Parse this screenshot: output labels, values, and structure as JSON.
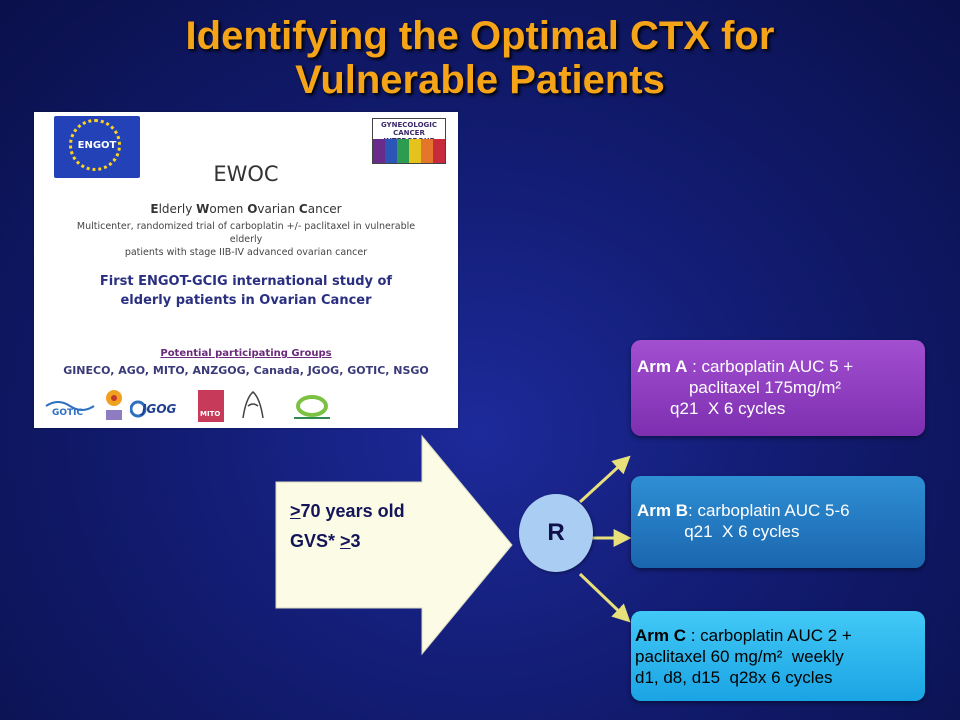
{
  "title": {
    "line1": "Identifying the Optimal CTX for",
    "line2": "Vulnerable Patients"
  },
  "inset": {
    "engot_label": "ENGOT",
    "gcig_label": "GYNECOLOGIC CANCER INTERGROUP",
    "acronym": "EWOC",
    "name_parts": [
      "E",
      "lderly ",
      "W",
      "omen ",
      "O",
      "varian ",
      "C",
      "ancer"
    ],
    "description_line1": "Multicenter, randomized trial of carboplatin +/- paclitaxel in vulnerable elderly",
    "description_line2": "patients with stage IIB-IV advanced ovarian cancer",
    "study_line1": "First ENGOT-GCIG international study of",
    "study_line2": "elderly patients in  Ovarian Cancer",
    "groups_heading": "Potential participating Groups",
    "groups_list": "GINECO, AGO, MITO, ANZGOG, Canada, JGOG, GOTIC, NSGO",
    "logo_labels": {
      "gotic": "GOTIC",
      "jgog": "JGOG",
      "mito": "MITO"
    }
  },
  "criteria": {
    "age_symbol": ">",
    "age_text": "70 years old",
    "gvs_prefix": "GVS* ",
    "gvs_symbol": ">",
    "gvs_value": "3"
  },
  "randomization_label": "R",
  "arms": {
    "a": {
      "label": "Arm A",
      "line1": " : carboplatin AUC 5 +",
      "line2": "           paclitaxel 175mg/m²",
      "line3": "       q21  X 6 cycles"
    },
    "b": {
      "label": "Arm B",
      "line1": ": carboplatin AUC 5-6",
      "line2": "          q21  X 6 cycles"
    },
    "c": {
      "label": "Arm C",
      "line1": " : carboplatin AUC 2 +",
      "line2": "paclitaxel 60 mg/m²  weekly",
      "line3": "d1, d8, d15  q28x 6 cycles"
    }
  },
  "colors": {
    "title": "#f6a417",
    "arm_a": "#8e3fc0",
    "arm_b": "#2179c0",
    "arm_c": "#2fb6ee",
    "arrow_fill": "#fbfbe6",
    "connector": "#e8e07a",
    "r_circle": "#a9cdf3"
  }
}
